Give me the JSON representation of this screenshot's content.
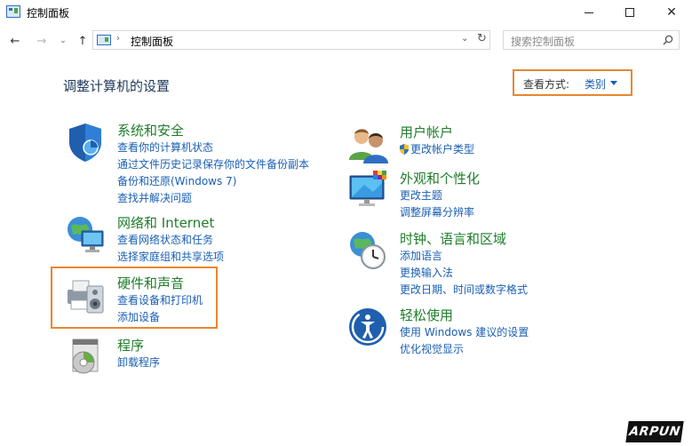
{
  "window": {
    "title": "控制面板",
    "controls": {
      "minimize": "minimize",
      "maximize": "maximize",
      "close": "✕"
    }
  },
  "nav": {
    "back": "←",
    "forward": "→",
    "recent": "⌄",
    "up": "↑",
    "address_sep": "›",
    "address": "控制面板",
    "address_dropdown": "⌄",
    "refresh": "↻",
    "search_placeholder": "搜索控制面板"
  },
  "main": {
    "title": "调整计算机的设置",
    "view_by": {
      "label": "查看方式:",
      "value": "类别"
    }
  },
  "categories_left": [
    {
      "name": "security",
      "icon": "shield-icon",
      "title": "系统和安全",
      "links": [
        "查看你的计算机状态",
        "通过文件历史记录保存你的文件备份副本",
        "备份和还原(Windows 7)",
        "查找并解决问题"
      ]
    },
    {
      "name": "network",
      "icon": "globe-network-icon",
      "title": "网络和 Internet",
      "links": [
        "查看网络状态和任务",
        "选择家庭组和共享选项"
      ]
    },
    {
      "name": "hardware",
      "icon": "printer-speaker-icon",
      "title": "硬件和声音",
      "links": [
        "查看设备和打印机",
        "添加设备"
      ]
    },
    {
      "name": "programs",
      "icon": "programs-disc-icon",
      "title": "程序",
      "links": [
        "卸载程序"
      ]
    }
  ],
  "categories_right": [
    {
      "name": "accounts",
      "icon": "users-icon",
      "title": "用户帐户",
      "links": [
        "更改帐户类型"
      ]
    },
    {
      "name": "appearance",
      "icon": "monitor-personalize-icon",
      "title": "外观和个性化",
      "links": [
        "更改主题",
        "调整屏幕分辨率"
      ]
    },
    {
      "name": "clock",
      "icon": "clock-globe-icon",
      "title": "时钟、语言和区域",
      "links": [
        "添加语言",
        "更换输入法",
        "更改日期、时间或数字格式"
      ]
    },
    {
      "name": "ease",
      "icon": "ease-of-access-icon",
      "title": "轻松使用",
      "links": [
        "使用 Windows 建议的设置",
        "优化视觉显示"
      ]
    }
  ],
  "watermark": "ARPUN",
  "colors": {
    "highlight": "#e8872f",
    "category_title": "#1e7d2a",
    "link": "#1a5fb4",
    "heading": "#1e395b"
  }
}
